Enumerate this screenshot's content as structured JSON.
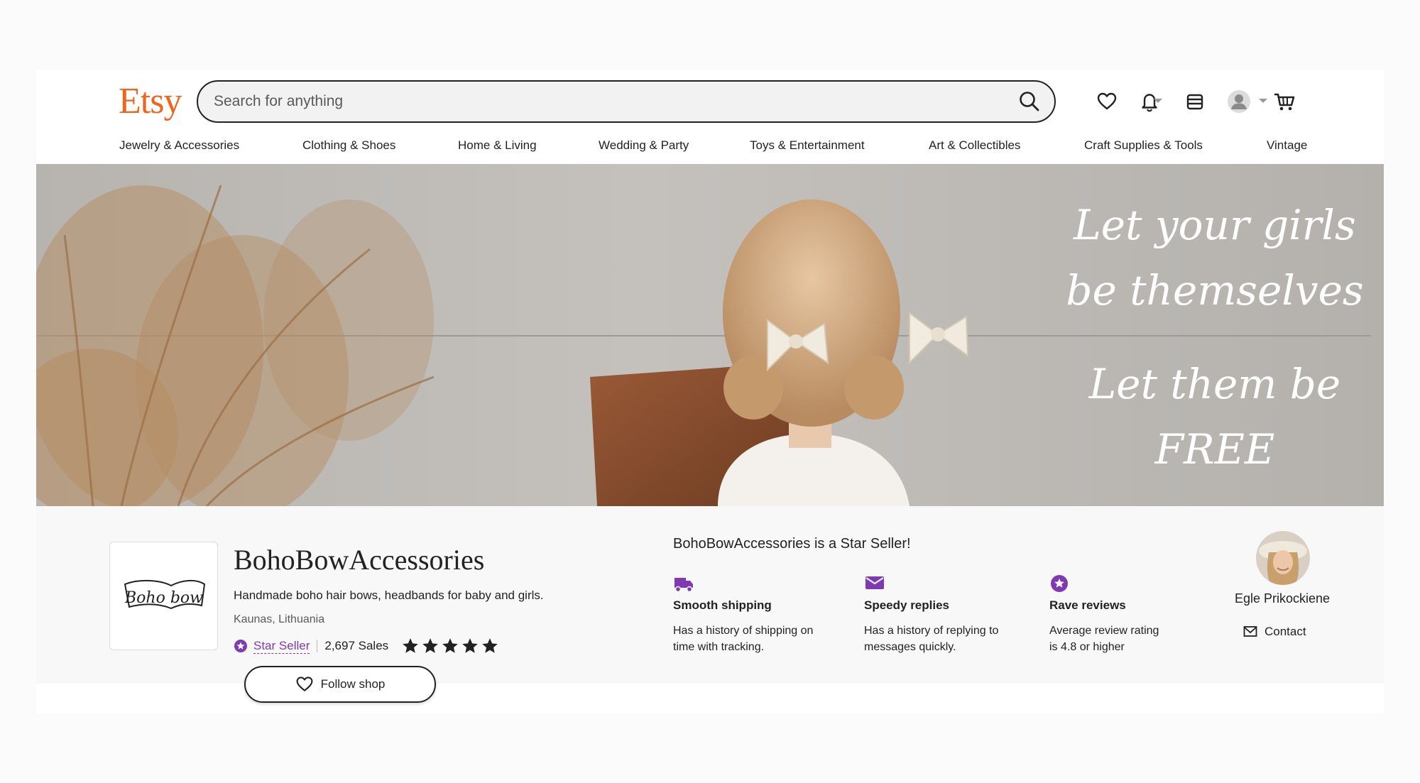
{
  "header": {
    "logo": "Etsy",
    "search_placeholder": "Search for anything"
  },
  "nav": {
    "items": [
      "Jewelry & Accessories",
      "Clothing & Shoes",
      "Home & Living",
      "Wedding & Party",
      "Toys & Entertainment",
      "Art & Collectibles",
      "Craft Supplies & Tools",
      "Vintage"
    ]
  },
  "banner": {
    "lines": [
      "Let your girls",
      "be themselves",
      "Let them be",
      "FREE"
    ]
  },
  "shop": {
    "logo_text": "Boho bow",
    "name": "BohoBowAccessories",
    "description": "Handmade boho hair bows, headbands for baby and girls.",
    "location": "Kaunas, Lithuania",
    "star_seller_label": "Star Seller",
    "sales": "2,697 Sales",
    "rating_stars": 5,
    "follow_label": "Follow shop"
  },
  "star_seller": {
    "title": "BohoBowAccessories is a Star Seller!",
    "features": [
      {
        "icon": "truck-icon",
        "title": "Smooth shipping",
        "text_1": "Has a history of shipping on",
        "text_2": "time with tracking."
      },
      {
        "icon": "envelope-icon",
        "title": "Speedy replies",
        "text_1": "Has a history of replying to",
        "text_2": "messages quickly."
      },
      {
        "icon": "star-badge-icon",
        "title": "Rave reviews",
        "text_1": "Average review rating",
        "text_2": "is 4.8 or higher"
      }
    ]
  },
  "owner": {
    "name": "Egle Prikockiene",
    "contact_label": "Contact"
  },
  "colors": {
    "brand": "#f1641e",
    "star_seller": "#7f3ab1",
    "text": "#222222"
  }
}
